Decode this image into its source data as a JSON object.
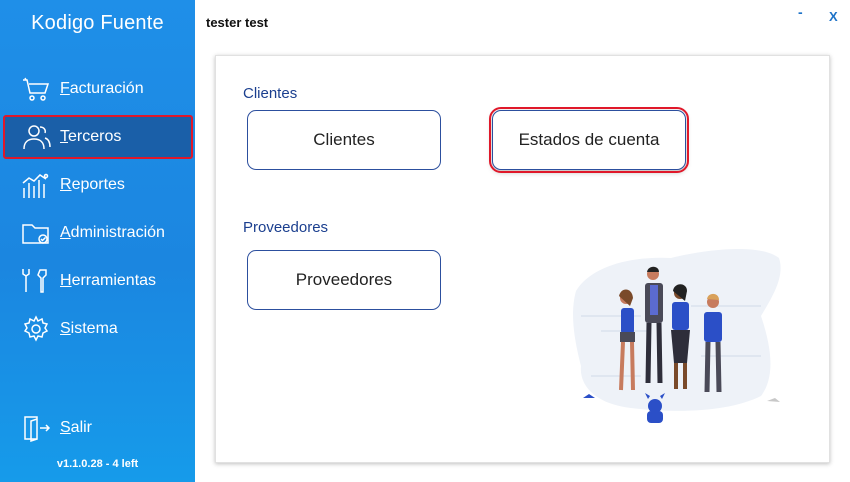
{
  "app": {
    "title": "Kodigo Fuente",
    "version": "v1.1.0.28 - 4 left"
  },
  "sidebar": {
    "items": [
      {
        "label": "Facturación",
        "icon": "cart-icon"
      },
      {
        "label": "Terceros",
        "icon": "users-icon",
        "active": true
      },
      {
        "label": "Reportes",
        "icon": "chart-icon"
      },
      {
        "label": "Administración",
        "icon": "folder-icon"
      },
      {
        "label": "Herramientas",
        "icon": "tools-icon"
      },
      {
        "label": "Sistema",
        "icon": "gear-icon"
      }
    ],
    "logout": {
      "label": "Salir",
      "icon": "exit-icon"
    }
  },
  "header": {
    "user": "tester test",
    "minimize": "-",
    "close": "X"
  },
  "main": {
    "sections": [
      {
        "title": "Clientes",
        "buttons": [
          "Clientes",
          "Estados de cuenta"
        ]
      },
      {
        "title": "Proveedores",
        "buttons": [
          "Proveedores"
        ]
      }
    ]
  },
  "colors": {
    "sidebar": "#1f8fe8",
    "active": "#1a5fa8",
    "accent": "#1b3f8f",
    "highlight": "#e0182a"
  }
}
